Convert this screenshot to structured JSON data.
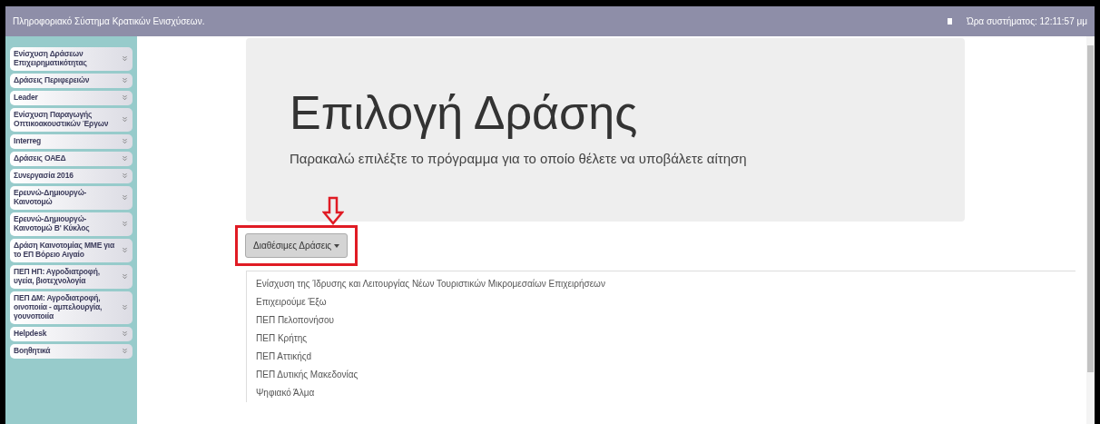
{
  "header": {
    "title": "Πληροφοριακό Σύστημα Κρατικών Ενισχύσεων.",
    "clock": "Ώρα συστήματος: 12:11:57 μμ"
  },
  "sidebar": {
    "items": [
      "Ενίσχυση Δράσεων Επιχειρηματικότητας",
      "Δράσεις Περιφερειών",
      "Leader",
      "Ενίσχυση Παραγωγής Οπτικοακουστικών Έργων",
      "Interreg",
      "Δράσεις ΟΑΕΔ",
      "Συνεργασία 2016",
      "Ερευνώ-Δημιουργώ-Καινοτομώ",
      "Ερευνώ-Δημιουργώ-Καινοτομώ Β' Κύκλος",
      "Δράση Καινοτομίας ΜΜΕ για το ΕΠ Βόρειο Αιγαίο",
      "ΠΕΠ ΗΠ: Αγροδιατροφή, υγεία, βιοτεχνολογία",
      "ΠΕΠ ΔΜ: Αγροδιατροφή, οινοποιία - αμπελουργία, γουνοποιία",
      "Helpdesk",
      "Βοηθητικά"
    ]
  },
  "jumbotron": {
    "title": "Επιλογή Δράσης",
    "subtitle": "Παρακαλώ επιλέξτε το πρόγραμμα για το οποίο θέλετε να υποβάλετε αίτηση"
  },
  "dropdown": {
    "label": "Διαθέσιμες Δράσεις",
    "expanded": true,
    "items": [
      "Ενίσχυση της Ίδρυσης και Λειτουργίας Νέων Τουριστικών Μικρομεσαίων Επιχειρήσεων",
      "Επιχειρούμε Έξω",
      "ΠΕΠ Πελοπονήσου",
      "ΠΕΠ Κρήτης",
      "ΠΕΠ Αττικήςd",
      "ΠΕΠ Δυτικής Μακεδονίας",
      "Ψηφιακό Άλμα"
    ]
  }
}
